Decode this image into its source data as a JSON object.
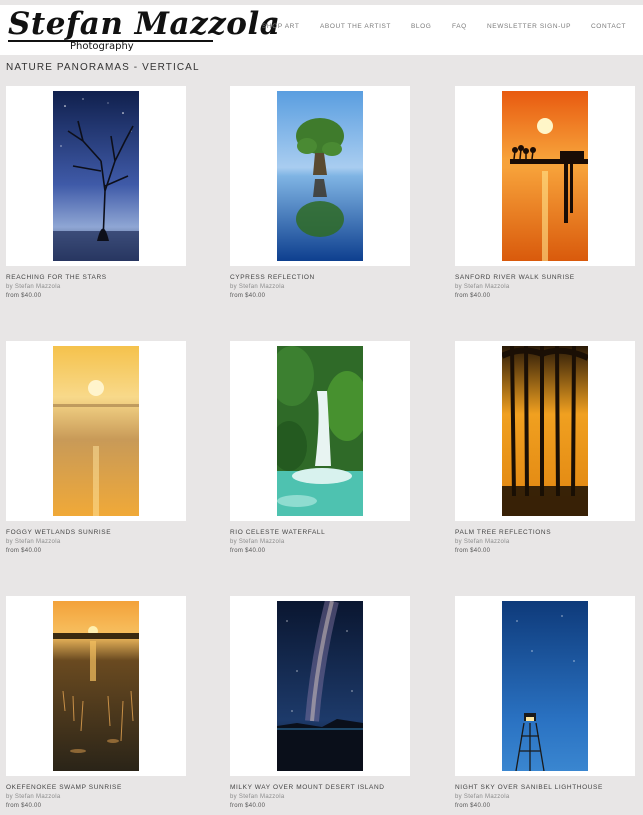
{
  "brand": {
    "name": "Stefan Mazzola",
    "tagline": "Photography"
  },
  "nav": [
    {
      "label": "SHOP ART"
    },
    {
      "label": "ABOUT THE ARTIST"
    },
    {
      "label": "BLOG"
    },
    {
      "label": "FAQ"
    },
    {
      "label": "NEWSLETTER SIGN-UP"
    },
    {
      "label": "CONTACT"
    }
  ],
  "page": {
    "title": "NATURE PANORAMAS - VERTICAL"
  },
  "products": [
    {
      "title": "REACHING FOR THE STARS",
      "by": "by Stefan Mazzola",
      "price": "from $40.00"
    },
    {
      "title": "CYPRESS REFLECTION",
      "by": "by Stefan Mazzola",
      "price": "from $40.00"
    },
    {
      "title": "SANFORD RIVER WALK SUNRISE",
      "by": "by Stefan Mazzola",
      "price": "from $40.00"
    },
    {
      "title": "FOGGY WETLANDS SUNRISE",
      "by": "by Stefan Mazzola",
      "price": "from $40.00"
    },
    {
      "title": "RIO CELESTE WATERFALL",
      "by": "by Stefan Mazzola",
      "price": "from $40.00"
    },
    {
      "title": "PALM TREE REFLECTIONS",
      "by": "by Stefan Mazzola",
      "price": "from $40.00"
    },
    {
      "title": "OKEFENOKEE SWAMP SUNRISE",
      "by": "by Stefan Mazzola",
      "price": "from $40.00"
    },
    {
      "title": "MILKY WAY OVER MOUNT DESERT ISLAND",
      "by": "by Stefan Mazzola",
      "price": "from $40.00"
    },
    {
      "title": "NIGHT SKY OVER SANIBEL LIGHTHOUSE",
      "by": "by Stefan Mazzola",
      "price": "from $40.00"
    }
  ],
  "colors": {
    "background": "#e8e6e6",
    "header": "#ffffff",
    "nav_text": "#7a7a7a"
  }
}
